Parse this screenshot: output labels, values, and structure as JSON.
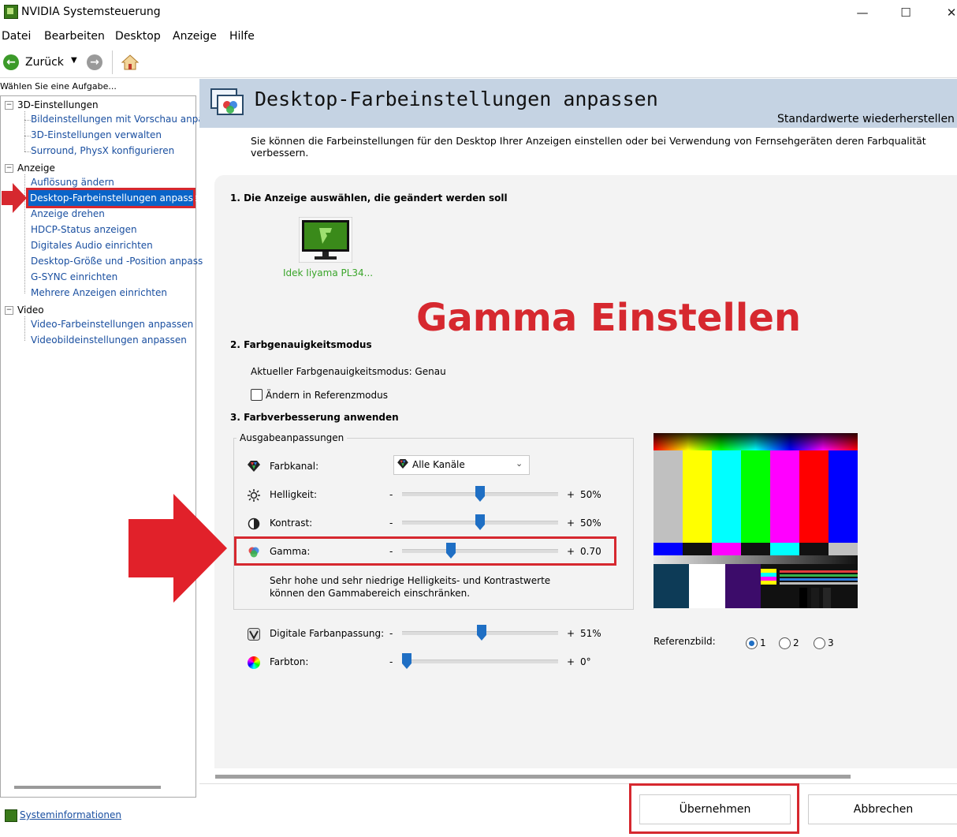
{
  "window": {
    "title": "NVIDIA Systemsteuerung",
    "controls": [
      "—",
      "☐",
      "✕"
    ]
  },
  "menu": [
    "Datei",
    "Bearbeiten",
    "Desktop",
    "Anzeige",
    "Hilfe"
  ],
  "toolbar": {
    "back_label": "Zurück"
  },
  "left": {
    "task_label": "Wählen Sie eine Aufgabe...",
    "groups": [
      {
        "label": "3D-Einstellungen",
        "items": [
          "Bildeinstellungen mit Vorschau anpa",
          "3D-Einstellungen verwalten",
          "Surround, PhysX konfigurieren"
        ]
      },
      {
        "label": "Anzeige",
        "items": [
          "Auflösung ändern",
          "Desktop-Farbeinstellungen anpassen",
          "Anzeige drehen",
          "HDCP-Status anzeigen",
          "Digitales Audio einrichten",
          "Desktop-Größe und -Position anpass",
          "G-SYNC einrichten",
          "Mehrere Anzeigen einrichten"
        ]
      },
      {
        "label": "Video",
        "items": [
          "Video-Farbeinstellungen anpassen",
          "Videobildeinstellungen anpassen"
        ]
      }
    ],
    "system_info": "Systeminformationen"
  },
  "page": {
    "title": "Desktop-Farbeinstellungen anpassen",
    "restore": "Standardwerte wiederherstellen",
    "description": "Sie können die Farbeinstellungen für den Desktop Ihrer Anzeigen einstellen oder bei Verwendung von Fernsehgeräten deren Farbqualität verbessern.",
    "section1": "1. Die Anzeige auswählen, die geändert werden soll",
    "monitor_name": "Idek Iiyama PL34...",
    "overlay": "Gamma Einstellen",
    "section2": "2. Farbgenauigkeitsmodus",
    "accuracy_mode": "Aktueller Farbgenauigkeitsmodus: Genau",
    "ref_mode_checkbox": "Ändern in Referenzmodus",
    "section3": "3. Farbverbesserung anwenden",
    "group_label": "Ausgabeanpassungen",
    "channel_label": "Farbkanal:",
    "channel_value": "Alle Kanäle",
    "sliders": [
      {
        "label": "Helligkeit:",
        "value": "50%",
        "position": 0.5
      },
      {
        "label": "Kontrast:",
        "value": "50%",
        "position": 0.5
      },
      {
        "label": "Gamma:",
        "value": "0.70",
        "position": 0.3
      },
      {
        "label": "Digitale Farbanpassung:",
        "value": "51%",
        "position": 0.51
      },
      {
        "label": "Farbton:",
        "value": "0°",
        "position": 0.0
      }
    ],
    "minus": "-",
    "plus": "+",
    "note": "Sehr hohe und sehr niedrige Helligkeits- und Kontrastwerte können den Gammabereich einschränken.",
    "ref_image_label": "Referenzbild:",
    "ref_options": [
      "1",
      "2",
      "3"
    ],
    "ref_selected": "1"
  },
  "buttons": {
    "apply": "Übernehmen",
    "cancel": "Abbrechen"
  },
  "colors": {
    "highlight": "#d6282f",
    "selection": "#0a64c8",
    "banner": "#c5d3e3",
    "slider": "#1f6fc4"
  }
}
